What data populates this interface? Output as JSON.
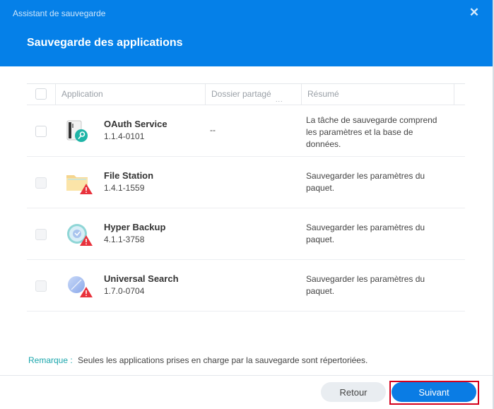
{
  "window": {
    "title": "Assistant de sauvegarde",
    "close_icon": "close-icon",
    "step_title": "Sauvegarde des applications"
  },
  "table": {
    "columns": [
      "Application",
      "Dossier partagé",
      "Résumé"
    ],
    "truncation_marker": "...",
    "rows": [
      {
        "name": "OAuth Service",
        "version": "1.1.4-0101",
        "shared_folder": "--",
        "summary": "La tâche de sauvegarde comprend les paramètres et la base de données.",
        "icon": "oauth-service-icon",
        "warning": false,
        "checkbox_enabled": true
      },
      {
        "name": "File Station",
        "version": "1.4.1-1559",
        "shared_folder": "",
        "summary": "Sauvegarder les paramètres du paquet.",
        "icon": "file-station-icon",
        "warning": true,
        "checkbox_enabled": false
      },
      {
        "name": "Hyper Backup",
        "version": "4.1.1-3758",
        "shared_folder": "",
        "summary": "Sauvegarder les paramètres du paquet.",
        "icon": "hyper-backup-icon",
        "warning": true,
        "checkbox_enabled": false
      },
      {
        "name": "Universal Search",
        "version": "1.7.0-0704",
        "shared_folder": "",
        "summary": "Sauvegarder les paramètres du paquet.",
        "icon": "universal-search-icon",
        "warning": true,
        "checkbox_enabled": false
      }
    ]
  },
  "remark": {
    "label": "Remarque :",
    "text": "Seules les applications prises en charge par la sauvegarde sont répertoriées."
  },
  "buttons": {
    "back": "Retour",
    "next": "Suivant"
  },
  "colors": {
    "header": "#0580e8",
    "primary_button": "#0a7ce4",
    "remark_label": "#1aa6ac",
    "warning": "#e8323c",
    "highlight": "#d4001c"
  }
}
